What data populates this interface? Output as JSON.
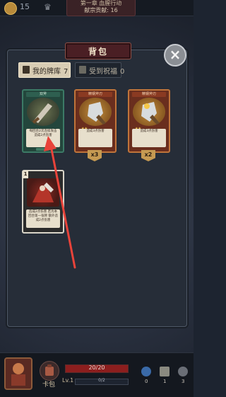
{
  "hud": {
    "coins": "15",
    "chapter_title": "第一章 血腥行动",
    "contribution": "献宗贡献: 16"
  },
  "modal": {
    "title": "背包",
    "close_glyph": "×"
  },
  "tabs": [
    {
      "label": "我的牌库",
      "count": "7"
    },
    {
      "label": "受到祝福",
      "count": "0"
    }
  ],
  "cards": [
    {
      "header": "双斧",
      "desc": "每回合2次连续攻击 造成2点伤害",
      "rarity": "common",
      "badge": ""
    },
    {
      "header": "精钢斧刃",
      "desc": "造成3点伤害",
      "rarity": "rare",
      "badge": "x3"
    },
    {
      "header": "精钢斧刃",
      "desc": "造成3点伤害",
      "rarity": "rare",
      "badge": "x2"
    },
    {
      "header": "",
      "desc": "造成2点伤害 若为本回合第一张牌 额外造成2点伤害",
      "rarity": "starter",
      "badge": "",
      "level": "1"
    }
  ],
  "bottom": {
    "hero_name": "卡包",
    "hp": "20/20",
    "hp_fraction": 1.0,
    "level": "Lv.1",
    "xp": "0/2",
    "resources": [
      {
        "name": "potion",
        "value": "0"
      },
      {
        "name": "hourglass",
        "value": "1"
      },
      {
        "name": "key",
        "value": "3"
      }
    ]
  },
  "colors": {
    "arrow": "#e8433a",
    "modal_bg": "#262d38",
    "title_plate": "#4a1f24"
  }
}
